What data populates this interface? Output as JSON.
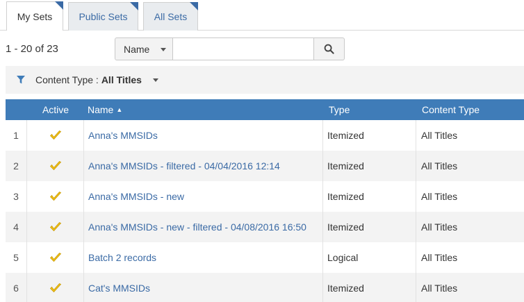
{
  "tabs": [
    {
      "label": "My Sets",
      "active": true
    },
    {
      "label": "Public Sets",
      "active": false
    },
    {
      "label": "All Sets",
      "active": false
    }
  ],
  "pager": {
    "text": "1 - 20 of 23"
  },
  "search": {
    "field_select": "Name",
    "value": "",
    "placeholder": ""
  },
  "filter": {
    "label": "Content Type :",
    "value": "All Titles"
  },
  "table": {
    "columns": {
      "num": "",
      "active": "Active",
      "name": "Name",
      "name_sort": "▲",
      "type": "Type",
      "content_type": "Content Type"
    },
    "rows": [
      {
        "num": "1",
        "name": "Anna's MMSIDs",
        "type": "Itemized",
        "content_type": "All Titles"
      },
      {
        "num": "2",
        "name": "Anna's MMSIDs - filtered - 04/04/2016 12:14",
        "type": "Itemized",
        "content_type": "All Titles"
      },
      {
        "num": "3",
        "name": "Anna's MMSIDs - new",
        "type": "Itemized",
        "content_type": "All Titles"
      },
      {
        "num": "4",
        "name": "Anna's MMSIDs - new - filtered - 04/08/2016 16:50",
        "type": "Itemized",
        "content_type": "All Titles"
      },
      {
        "num": "5",
        "name": "Batch 2 records",
        "type": "Logical",
        "content_type": "All Titles"
      },
      {
        "num": "6",
        "name": "Cat's MMSIDs",
        "type": "Itemized",
        "content_type": "All Titles"
      }
    ]
  },
  "colors": {
    "header_bg": "#3f7cb8",
    "link": "#3a6aa5",
    "check": "#f2c21b",
    "tab_corner": "#3a6aa5"
  }
}
